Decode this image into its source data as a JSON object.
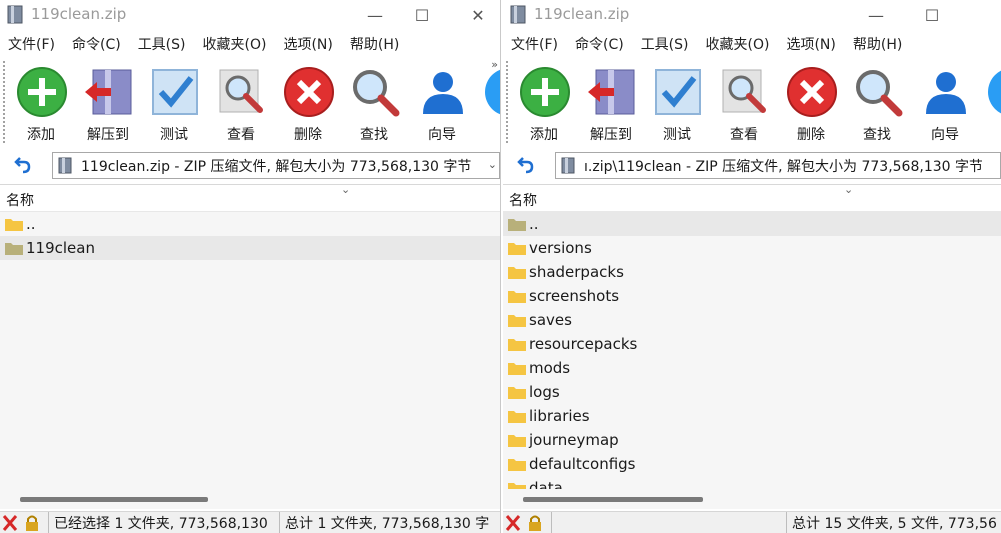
{
  "left": {
    "title": "119clean.zip",
    "menu": [
      "文件(F)",
      "命令(C)",
      "工具(S)",
      "收藏夹(O)",
      "选项(N)",
      "帮助(H)"
    ],
    "toolbar": [
      "添加",
      "解压到",
      "测试",
      "查看",
      "删除",
      "查找",
      "向导"
    ],
    "address": "119clean.zip - ZIP 压缩文件, 解包大小为 773,568,130 字节",
    "column_header": "名称",
    "rows": [
      "..",
      "119clean"
    ],
    "status_selected": "已经选择 1 文件夹, 773,568,130",
    "status_total": "总计 1 文件夹, 773,568,130 字"
  },
  "right": {
    "title": "119clean.zip",
    "menu": [
      "文件(F)",
      "命令(C)",
      "工具(S)",
      "收藏夹(O)",
      "选项(N)",
      "帮助(H)"
    ],
    "toolbar": [
      "添加",
      "解压到",
      "测试",
      "查看",
      "删除",
      "查找",
      "向导"
    ],
    "address": "ı.zip\\119clean - ZIP 压缩文件, 解包大小为 773,568,130 字节",
    "column_header": "名称",
    "rows": [
      "..",
      "versions",
      "shaderpacks",
      "screenshots",
      "saves",
      "resourcepacks",
      "mods",
      "logs",
      "libraries",
      "journeymap",
      "defaultconfigs",
      "data"
    ],
    "status_total": "总计 15 文件夹, 5 文件, 773,56"
  },
  "colors": {
    "add": "#3cb043",
    "delete": "#e03030",
    "folder": "#f5c542",
    "parent_folder": "#b8b07a"
  }
}
